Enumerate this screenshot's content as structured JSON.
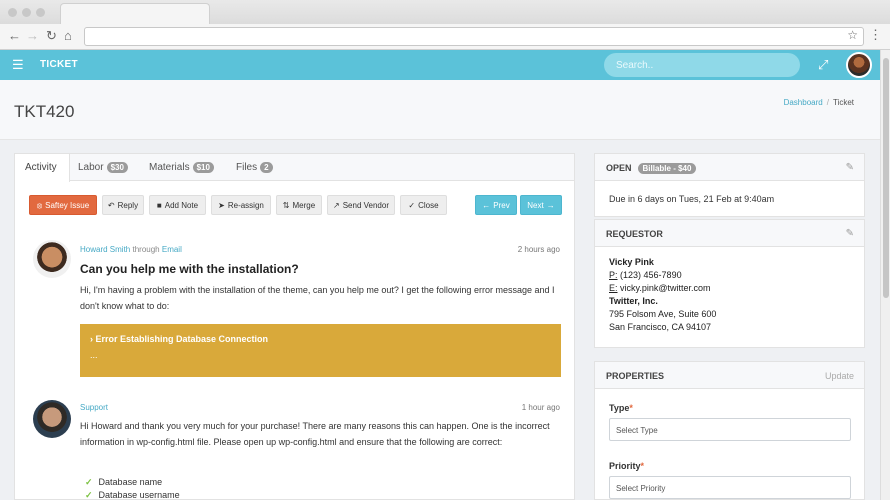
{
  "browser": {
    "back_icon": "arrow-left-icon",
    "forward_icon": "arrow-right-icon",
    "reload_icon": "reload-icon",
    "home_icon": "home-icon",
    "star_icon": "star-icon",
    "menu_icon": "kebab-menu-icon"
  },
  "header": {
    "title": "TICKET",
    "search_placeholder": "Search.."
  },
  "page": {
    "title": "TKT420",
    "breadcrumb": {
      "dashboard": "Dashboard",
      "separator": "/",
      "current": "Ticket"
    }
  },
  "tabs": [
    {
      "label": "Activity",
      "badge": null
    },
    {
      "label": "Labor",
      "badge": "$30"
    },
    {
      "label": "Materials",
      "badge": "$10"
    },
    {
      "label": "Files",
      "badge": "2"
    }
  ],
  "toolbar": {
    "safety": "Saftey Issue",
    "reply": "Reply",
    "add_note": "Add Note",
    "reassign": "Re-assign",
    "merge": "Merge",
    "send_vendor": "Send Vendor",
    "close": "Close",
    "prev": "Prev",
    "next": "Next"
  },
  "messages": [
    {
      "author": "Howard Smith",
      "via_word": "through",
      "channel": "Email",
      "time": "2 hours ago",
      "subject": "Can you help me with the installation?",
      "body": "Hi, I'm having a problem with the installation of the theme, can you help me out? I get the following error message and I don't know what to do:",
      "error_title": "Error Establishing Database Connection",
      "error_detail": "..."
    },
    {
      "author": "Support",
      "time": "1 hour ago",
      "body": "Hi Howard and thank you very much for your purchase! There are many reasons this can happen. One is the incorrect information in wp-config.html file. Please open up wp-config.html and ensure that the following are correct:",
      "checklist": [
        "Database name",
        "Database username"
      ]
    }
  ],
  "status_card": {
    "status": "OPEN",
    "billable": "Billable - $40",
    "due": "Due in 6 days on Tues, 21 Feb at 9:40am"
  },
  "requestor": {
    "heading": "REQUESTOR",
    "name": "Vicky Pink",
    "phone_label": "P:",
    "phone": "(123) 456-7890",
    "email_label": "E:",
    "email": "vicky.pink@twitter.com",
    "company": "Twitter, Inc.",
    "address1": "795 Folsom Ave, Suite 600",
    "address2": "San Francisco, CA 94107"
  },
  "properties": {
    "heading": "PROPERTIES",
    "update": "Update",
    "type_label": "Type",
    "type_value": "Select Type",
    "priority_label": "Priority",
    "priority_value": "Select Priority",
    "required_mark": "*"
  },
  "colors": {
    "accent": "#5bc2d9",
    "safety": "#e2693f",
    "error_box": "#d9a93a",
    "check": "#7cc242",
    "link": "#46a9c5"
  }
}
